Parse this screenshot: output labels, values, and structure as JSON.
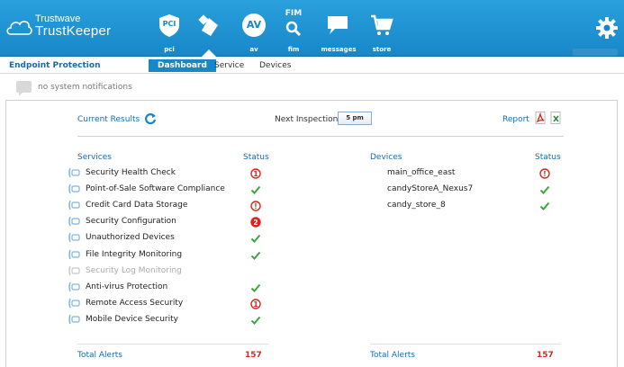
{
  "brand": {
    "small": "Trustwave",
    "big": "TrustKeeper",
    "trademark": "®"
  },
  "nav": [
    {
      "label": "pci",
      "icon": "pci-icon",
      "glyph": "PCI"
    },
    {
      "label": "",
      "icon": "endpoint-protection-icon",
      "active": true
    },
    {
      "label": "av",
      "icon": "av-icon",
      "glyph": "AV"
    },
    {
      "label": "fim",
      "icon": "fim-icon",
      "glyph": "FIM"
    },
    {
      "label": "messages",
      "icon": "messages-icon"
    },
    {
      "label": "store",
      "icon": "store-cart-icon"
    }
  ],
  "section_title": "Endpoint Protection",
  "tabs": [
    {
      "label": "Dashboard",
      "active": true
    },
    {
      "label": "Service",
      "active": false
    },
    {
      "label": "Devices",
      "active": false
    }
  ],
  "notifications": {
    "text": "no system notifications"
  },
  "toolbar": {
    "current_results": "Current Results",
    "next_inspection_label": "Next Inspection",
    "next_inspection_time": "5 pm",
    "report_label": "Report"
  },
  "services": {
    "header": "Services",
    "status_header": "Status",
    "rows": [
      {
        "label": "Security Health Check",
        "icon": "health-check-icon",
        "status": "alert",
        "count": "1"
      },
      {
        "label": "Point-of-Sale Software Compliance",
        "icon": "pos-icon",
        "status": "ok"
      },
      {
        "label": "Credit Card Data Storage",
        "icon": "database-icon",
        "status": "alert",
        "count": "!"
      },
      {
        "label": "Security Configuration",
        "icon": "config-gear-icon",
        "status": "alert-filled",
        "count": "2"
      },
      {
        "label": "Unauthorized Devices",
        "icon": "warning-device-icon",
        "status": "ok"
      },
      {
        "label": "File Integrity Monitoring",
        "icon": "magnifier-icon",
        "status": "ok"
      },
      {
        "label": "Security Log Monitoring",
        "icon": "log-icon",
        "status": "none",
        "disabled": true
      },
      {
        "label": "Anti-virus Protection",
        "icon": "antivirus-icon",
        "status": "ok"
      },
      {
        "label": "Remote Access Security",
        "icon": "cloud-icon",
        "status": "alert",
        "count": "1"
      },
      {
        "label": "Mobile Device Security",
        "icon": "mobile-icon",
        "status": "ok"
      }
    ],
    "total_label": "Total Alerts",
    "total_value": "157"
  },
  "devices": {
    "header": "Devices",
    "status_header": "Status",
    "rows": [
      {
        "label": "main_office_east",
        "status": "alert",
        "count": "!"
      },
      {
        "label": "candyStoreA_Nexus7",
        "status": "ok"
      },
      {
        "label": "candy_store_8",
        "status": "ok"
      }
    ],
    "total_label": "Total Alerts",
    "total_value": "157"
  },
  "colors": {
    "accent": "#1787c9",
    "link": "#1a6aa8",
    "alert": "#d9261c",
    "ok": "#3aa83a"
  }
}
